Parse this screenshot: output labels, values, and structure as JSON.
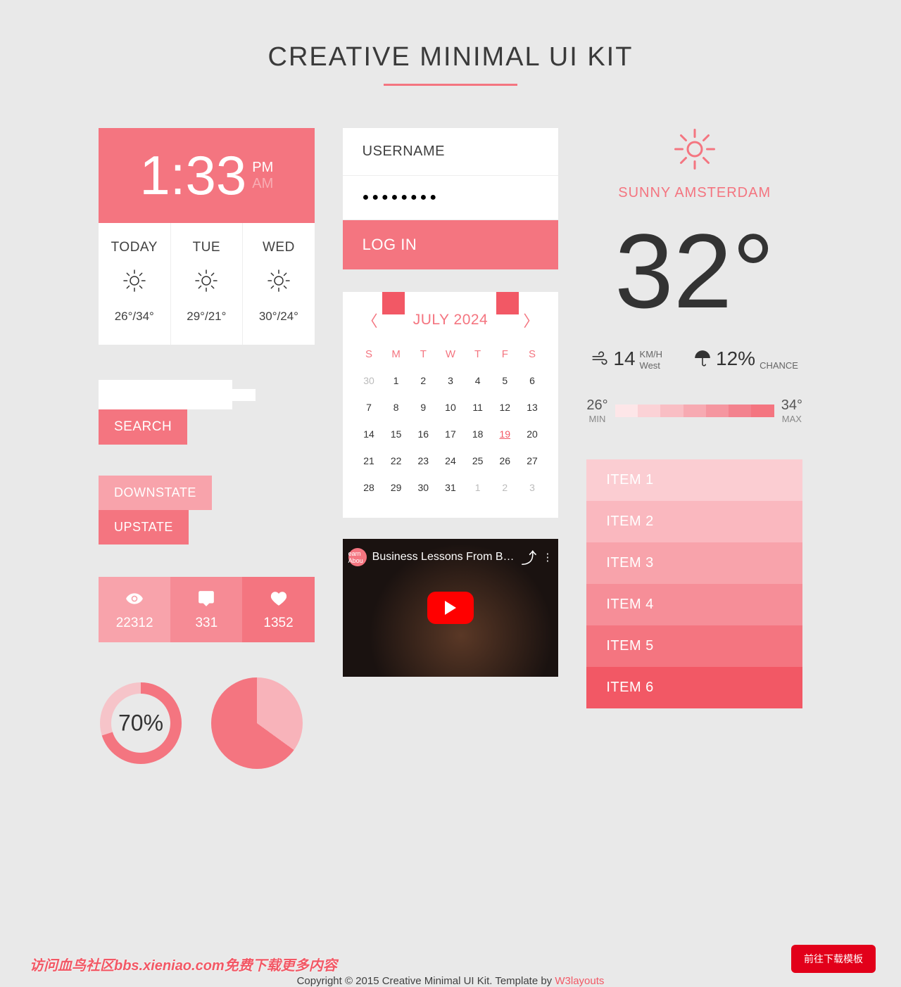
{
  "title": "CREATIVE MINIMAL UI KIT",
  "clock": {
    "time": "1:33",
    "pm": "PM",
    "am": "AM",
    "days": [
      {
        "name": "TODAY",
        "temp": "26°/34°"
      },
      {
        "name": "TUE",
        "temp": "29°/21°"
      },
      {
        "name": "WED",
        "temp": "30°/24°"
      }
    ]
  },
  "search": {
    "button": "SEARCH",
    "placeholder": ""
  },
  "states": {
    "down": "DOWNSTATE",
    "up": "UPSTATE"
  },
  "stats": {
    "views": "22312",
    "comments": "331",
    "likes": "1352"
  },
  "donut_pct": "70%",
  "login": {
    "username_label": "USERNAME",
    "password_dots": "●●●●●●●●",
    "submit": "LOG IN"
  },
  "calendar": {
    "month": "JULY 2024",
    "dow": [
      "S",
      "M",
      "T",
      "W",
      "T",
      "F",
      "S"
    ],
    "rows": [
      [
        "30",
        "1",
        "2",
        "3",
        "4",
        "5",
        "6"
      ],
      [
        "7",
        "8",
        "9",
        "10",
        "11",
        "12",
        "13"
      ],
      [
        "14",
        "15",
        "16",
        "17",
        "18",
        "19",
        "20"
      ],
      [
        "21",
        "22",
        "23",
        "24",
        "25",
        "26",
        "27"
      ],
      [
        "28",
        "29",
        "30",
        "31",
        "1",
        "2",
        "3"
      ]
    ],
    "today": "19"
  },
  "video": {
    "channel": "earn Abou",
    "title": "Business Lessons From Bil…"
  },
  "weather": {
    "condition": "SUNNY AMSTERDAM",
    "temp": "32°",
    "wind_val": "14",
    "wind_unit": "KM/H",
    "wind_dir": "West",
    "rain_val": "12%",
    "rain_lbl": "CHANCE",
    "min_val": "26°",
    "min_lbl": "MIN",
    "max_val": "34°",
    "max_lbl": "MAX"
  },
  "items": [
    "ITEM 1",
    "ITEM 2",
    "ITEM 3",
    "ITEM 4",
    "ITEM 5",
    "ITEM 6"
  ],
  "banner_text": "访问血鸟社区bbs.xieniao.com免费下载更多内容",
  "copyright_prefix": "Copyright © 2015 Creative Minimal UI Kit. Template by ",
  "copyright_link": "W3layouts",
  "download_btn": "前往下载模板"
}
